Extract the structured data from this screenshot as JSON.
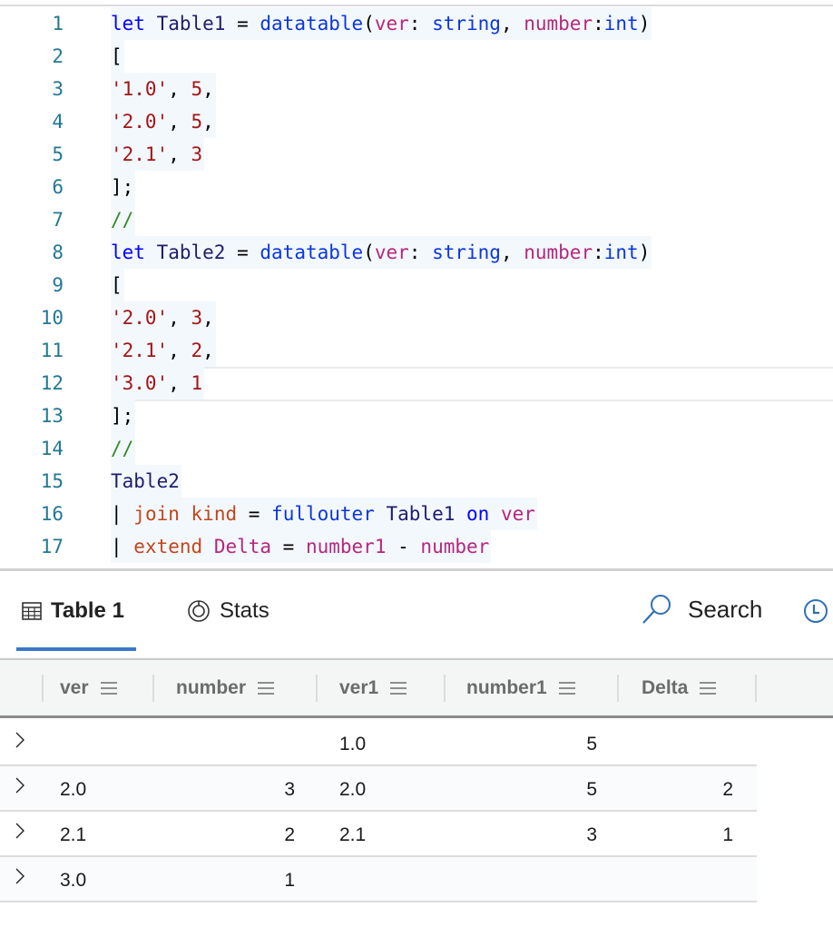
{
  "editor": {
    "current_line": 12,
    "lines": [
      {
        "n": "1",
        "tokens": [
          [
            "let",
            "kw"
          ],
          [
            " ",
            "pl"
          ],
          [
            "Table1",
            "id"
          ],
          [
            " = ",
            "pl"
          ],
          [
            "datatable",
            "fn"
          ],
          [
            "(",
            "pl"
          ],
          [
            "ver",
            "col"
          ],
          [
            ": ",
            "pl"
          ],
          [
            "string",
            "fn"
          ],
          [
            ", ",
            "pl"
          ],
          [
            "number",
            "col"
          ],
          [
            ":",
            "pl"
          ],
          [
            "int",
            "fn"
          ],
          [
            ")",
            "pl"
          ]
        ]
      },
      {
        "n": "2",
        "tokens": [
          [
            "[",
            "pl"
          ]
        ]
      },
      {
        "n": "3",
        "tokens": [
          [
            "'1.0'",
            "str"
          ],
          [
            ", ",
            "pl"
          ],
          [
            "5",
            "num"
          ],
          [
            ",",
            "pl"
          ]
        ]
      },
      {
        "n": "4",
        "tokens": [
          [
            "'2.0'",
            "str"
          ],
          [
            ", ",
            "pl"
          ],
          [
            "5",
            "num"
          ],
          [
            ",",
            "pl"
          ]
        ]
      },
      {
        "n": "5",
        "tokens": [
          [
            "'2.1'",
            "str"
          ],
          [
            ", ",
            "pl"
          ],
          [
            "3",
            "num"
          ]
        ]
      },
      {
        "n": "6",
        "tokens": [
          [
            "];",
            "pl"
          ]
        ]
      },
      {
        "n": "7",
        "tokens": [
          [
            "//",
            "cm"
          ]
        ]
      },
      {
        "n": "8",
        "tokens": [
          [
            "let",
            "kw"
          ],
          [
            " ",
            "pl"
          ],
          [
            "Table2",
            "id"
          ],
          [
            " = ",
            "pl"
          ],
          [
            "datatable",
            "fn"
          ],
          [
            "(",
            "pl"
          ],
          [
            "ver",
            "col"
          ],
          [
            ": ",
            "pl"
          ],
          [
            "string",
            "fn"
          ],
          [
            ", ",
            "pl"
          ],
          [
            "number",
            "col"
          ],
          [
            ":",
            "pl"
          ],
          [
            "int",
            "fn"
          ],
          [
            ")",
            "pl"
          ]
        ]
      },
      {
        "n": "9",
        "tokens": [
          [
            "[",
            "pl"
          ]
        ]
      },
      {
        "n": "10",
        "tokens": [
          [
            "'2.0'",
            "str"
          ],
          [
            ", ",
            "pl"
          ],
          [
            "3",
            "num"
          ],
          [
            ",",
            "pl"
          ]
        ]
      },
      {
        "n": "11",
        "tokens": [
          [
            "'2.1'",
            "str"
          ],
          [
            ", ",
            "pl"
          ],
          [
            "2",
            "num"
          ],
          [
            ",",
            "pl"
          ]
        ]
      },
      {
        "n": "12",
        "tokens": [
          [
            "'3.0'",
            "str"
          ],
          [
            ", ",
            "pl"
          ],
          [
            "1",
            "num"
          ]
        ]
      },
      {
        "n": "13",
        "tokens": [
          [
            "];",
            "pl"
          ]
        ]
      },
      {
        "n": "14",
        "tokens": [
          [
            "//",
            "cm"
          ]
        ]
      },
      {
        "n": "15",
        "tokens": [
          [
            "Table2",
            "id"
          ]
        ]
      },
      {
        "n": "16",
        "tokens": [
          [
            "| ",
            "pl"
          ],
          [
            "join",
            "op"
          ],
          [
            " ",
            "pl"
          ],
          [
            "kind",
            "op"
          ],
          [
            " = ",
            "pl"
          ],
          [
            "fullouter",
            "fn"
          ],
          [
            " ",
            "pl"
          ],
          [
            "Table1",
            "id"
          ],
          [
            " ",
            "pl"
          ],
          [
            "on",
            "kw"
          ],
          [
            " ",
            "pl"
          ],
          [
            "ver",
            "col"
          ]
        ]
      },
      {
        "n": "17",
        "tokens": [
          [
            "| ",
            "pl"
          ],
          [
            "extend",
            "op"
          ],
          [
            " ",
            "pl"
          ],
          [
            "Delta",
            "col"
          ],
          [
            " = ",
            "pl"
          ],
          [
            "number1",
            "col"
          ],
          [
            " - ",
            "pl"
          ],
          [
            "number",
            "col"
          ]
        ]
      }
    ]
  },
  "results": {
    "tabs": [
      {
        "label": "Table 1",
        "icon": "table-icon",
        "active": true
      },
      {
        "label": "Stats",
        "icon": "stats-icon",
        "active": false
      }
    ],
    "search_label": "Search",
    "accent_color": "#3a78c9",
    "columns": [
      "ver",
      "number",
      "ver1",
      "number1",
      "Delta"
    ],
    "rows": [
      [
        "",
        "",
        "1.0",
        "5",
        ""
      ],
      [
        "2.0",
        "3",
        "2.0",
        "5",
        "2"
      ],
      [
        "2.1",
        "2",
        "2.1",
        "3",
        "1"
      ],
      [
        "3.0",
        "1",
        "",
        "",
        ""
      ]
    ]
  }
}
